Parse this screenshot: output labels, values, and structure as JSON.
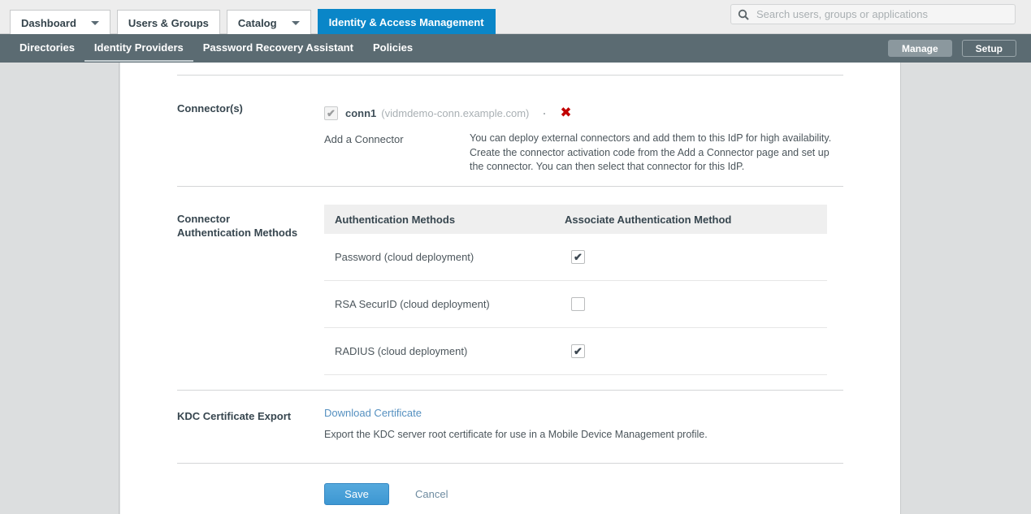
{
  "top_nav": {
    "tabs": [
      {
        "label": "Dashboard",
        "has_caret": true,
        "active": false
      },
      {
        "label": "Users & Groups",
        "has_caret": false,
        "active": false
      },
      {
        "label": "Catalog",
        "has_caret": true,
        "active": false
      },
      {
        "label": "Identity & Access Management",
        "has_caret": false,
        "active": true
      }
    ],
    "search": {
      "placeholder": "Search users, groups or applications",
      "value": "",
      "icon": "search-icon"
    }
  },
  "sub_nav": {
    "items": [
      {
        "label": "Directories",
        "active": false
      },
      {
        "label": "Identity Providers",
        "active": true
      },
      {
        "label": "Password Recovery Assistant",
        "active": false
      },
      {
        "label": "Policies",
        "active": false
      }
    ],
    "manage_label": "Manage",
    "setup_label": "Setup"
  },
  "connectors": {
    "label": "Connector(s)",
    "selected": {
      "checked": true,
      "name": "conn1",
      "host": "(vidmdemo-conn.example.com)",
      "delete_icon": "delete-x-icon",
      "delete_glyph": "✖"
    },
    "add_link": "Add a Connector",
    "description": "You can deploy external connectors and add them to this IdP for high availability. Create the connector activation code from the Add a Connector page and set up the connector. You can then select that connector for this IdP."
  },
  "auth_methods": {
    "label_line1": "Connector",
    "label_line2": "Authentication Methods",
    "columns": [
      "Authentication Methods",
      "Associate Authentication Method"
    ],
    "rows": [
      {
        "method": "Password (cloud deployment)",
        "associated": true
      },
      {
        "method": "RSA SecurID (cloud deployment)",
        "associated": false
      },
      {
        "method": "RADIUS (cloud deployment)",
        "associated": true
      }
    ],
    "tick_glyph": "✔"
  },
  "kdc": {
    "label": "KDC Certificate Export",
    "link": "Download Certificate",
    "description": "Export the KDC server root certificate for use in a Mobile Device Management profile."
  },
  "footer": {
    "save_label": "Save",
    "cancel_label": "Cancel"
  },
  "colors": {
    "accent_blue": "#0a86c8",
    "subnav_bg": "#5b6b72",
    "link_blue": "#5590c0",
    "save_blue": "#3d97d2",
    "delete_red": "#c10000"
  }
}
